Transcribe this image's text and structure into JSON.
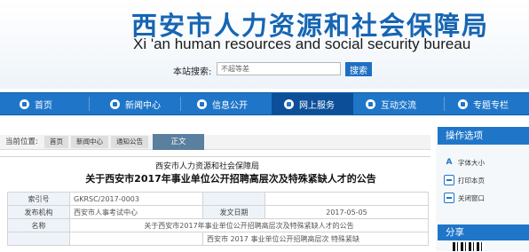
{
  "header": {
    "title_cn": "西安市人力资源和社会保障局",
    "title_en": "Xi 'an human resources and social security bureau",
    "search_label": "本站搜索:",
    "search_value": "不超等差",
    "search_button": "搜索"
  },
  "nav": [
    {
      "label": "首页"
    },
    {
      "label": "新闻中心"
    },
    {
      "label": "信息公开"
    },
    {
      "label": "网上服务"
    },
    {
      "label": "互动交流"
    },
    {
      "label": "专题专栏"
    }
  ],
  "breadcrumb": {
    "label": "当前位置:",
    "items": [
      "首页",
      "新闻中心",
      "通知公告"
    ],
    "current": "正文"
  },
  "article": {
    "org": "西安市人力资源和社会保障局",
    "title": "关于西安市2017年事业单位公开招聘高层次及特殊紧缺人才的公告",
    "meta": {
      "index_key": "索引号",
      "index_value": "GKRSC/2017-0003",
      "agency_key": "发布机构",
      "agency_value": "西安市人事考试中心",
      "date_key": "发文日期",
      "date_value": "2017-05-05",
      "name_key": "名称",
      "name_value": "关于西安市2017年事业单位公开招聘高层次及特殊紧缺人才的公告",
      "doc_value": "西安市 2017 事业单位公开招聘高层次 特殊紧缺"
    }
  },
  "sidebar": {
    "ops_title": "操作选项",
    "tools": [
      {
        "label": "字体大小",
        "icon": "font-size-icon"
      },
      {
        "label": "打印本页",
        "icon": "print-icon"
      },
      {
        "label": "关闭窗口",
        "icon": "close-window-icon"
      }
    ],
    "share_title": "分享"
  },
  "colors": {
    "brand_blue": "#1f76c9",
    "nav_active": "#0c4f98",
    "title_blue": "#1665b3"
  }
}
